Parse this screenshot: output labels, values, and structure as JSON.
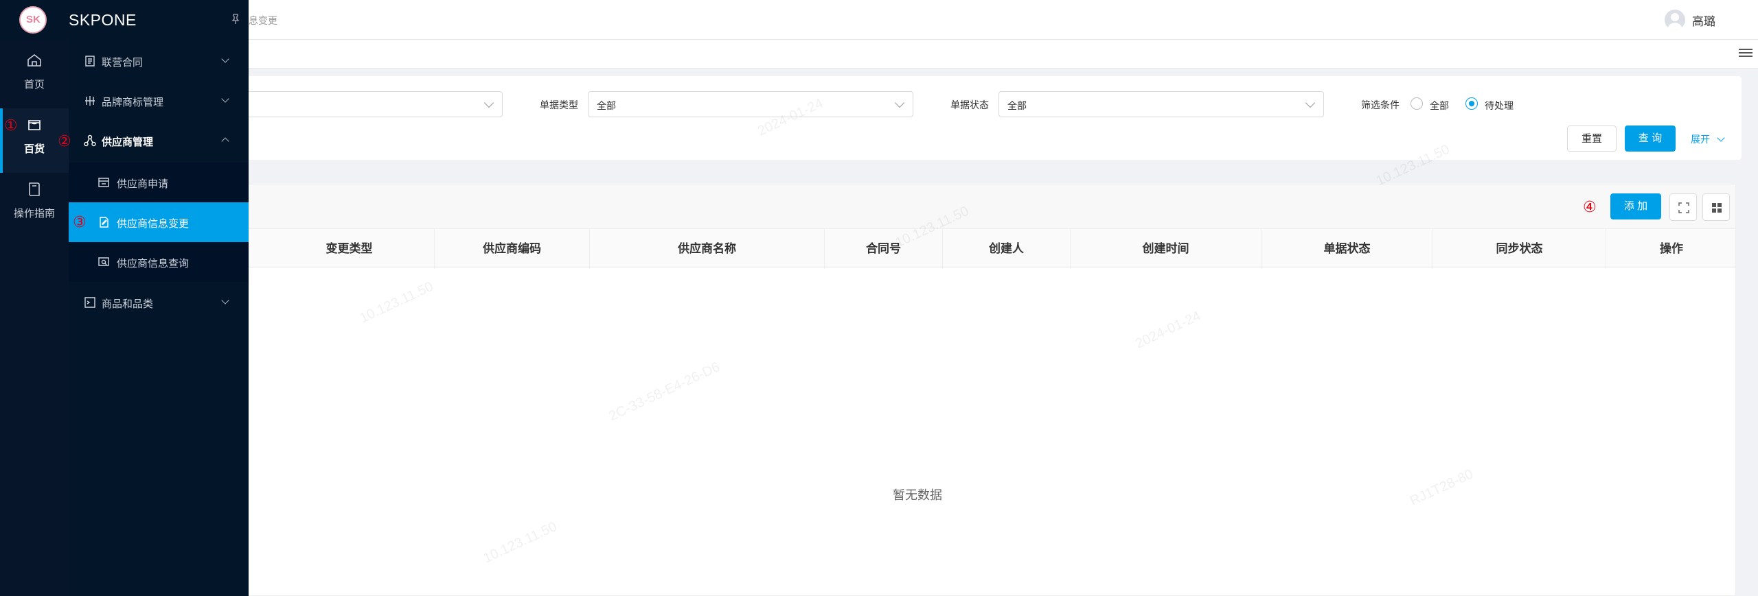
{
  "brand": {
    "name": "SKPONE"
  },
  "header": {
    "breadcrumb_tail": "息变更",
    "username": "高璐"
  },
  "nav_primary": [
    {
      "label": "首页",
      "icon": "home-icon"
    },
    {
      "label": "百货",
      "icon": "store-icon",
      "marker": "①"
    },
    {
      "label": "操作指南",
      "icon": "book-icon"
    }
  ],
  "nav_secondary": {
    "groups": [
      {
        "label": "联营合同",
        "icon": "contract-icon"
      },
      {
        "label": "品牌商标管理",
        "icon": "brand-icon"
      },
      {
        "label": "供应商管理",
        "icon": "supplier-icon",
        "marker": "②"
      },
      {
        "label": "商品和品类",
        "icon": "goods-icon"
      }
    ],
    "sub_items": [
      {
        "label": "供应商申请",
        "icon": "apply-icon"
      },
      {
        "label": "供应商信息变更",
        "icon": "edit-icon",
        "marker": "③"
      },
      {
        "label": "供应商信息查询",
        "icon": "query-icon"
      }
    ]
  },
  "filters": {
    "doc_type_label": "单据类型",
    "doc_type_value": "全部",
    "doc_status_label": "单据状态",
    "doc_status_value": "全部",
    "condition_label": "筛选条件",
    "option_all": "全部",
    "option_pending": "待处理",
    "reset": "重置",
    "search": "查 询",
    "expand": "展开"
  },
  "table": {
    "add_button": "添 加",
    "add_marker": "④",
    "columns": [
      "变更类型",
      "供应商编码",
      "供应商名称",
      "合同号",
      "创建人",
      "创建时间",
      "单据状态",
      "同步状态",
      "操作"
    ],
    "empty_text": "暂无数据"
  },
  "colors": {
    "accent": "#00a0e9",
    "nav_bg": "#031529",
    "marker": "#e60012"
  }
}
